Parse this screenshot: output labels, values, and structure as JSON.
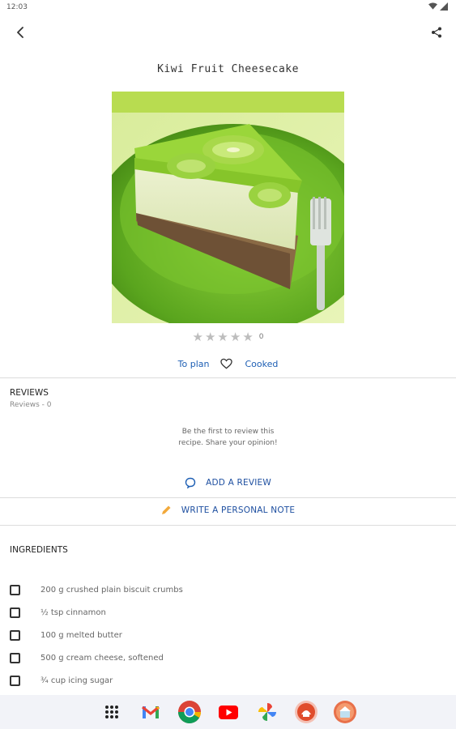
{
  "status": {
    "time": "12:03"
  },
  "recipe": {
    "title": "Kiwi Fruit Cheesecake",
    "image_alt": "Kiwi fruit cheesecake slice on green plate",
    "rating_count": "0",
    "stars": 0
  },
  "actions": {
    "to_plan": "To plan",
    "cooked": "Cooked"
  },
  "reviews": {
    "title": "REVIEWS",
    "count_text": "Reviews - 0",
    "empty_line1": "Be the first to review this",
    "empty_line2": "recipe. Share your opinion!",
    "add_review": "ADD A REVIEW"
  },
  "note": {
    "label": "WRITE A PERSONAL NOTE"
  },
  "ingredients": {
    "title": "INGREDIENTS",
    "items": [
      "200 g crushed plain biscuit crumbs",
      "½ tsp cinnamon",
      "100 g melted butter",
      "500 g cream cheese, softened",
      "¾ cup icing sugar"
    ]
  },
  "dock": {
    "apps": [
      "app-drawer",
      "gmail",
      "chrome",
      "youtube",
      "photos",
      "recipe-app-1",
      "recipe-app-2"
    ]
  },
  "colors": {
    "link": "#1e5fb4",
    "accent_note": "#f2a93b",
    "divider": "#dcdcdc"
  }
}
